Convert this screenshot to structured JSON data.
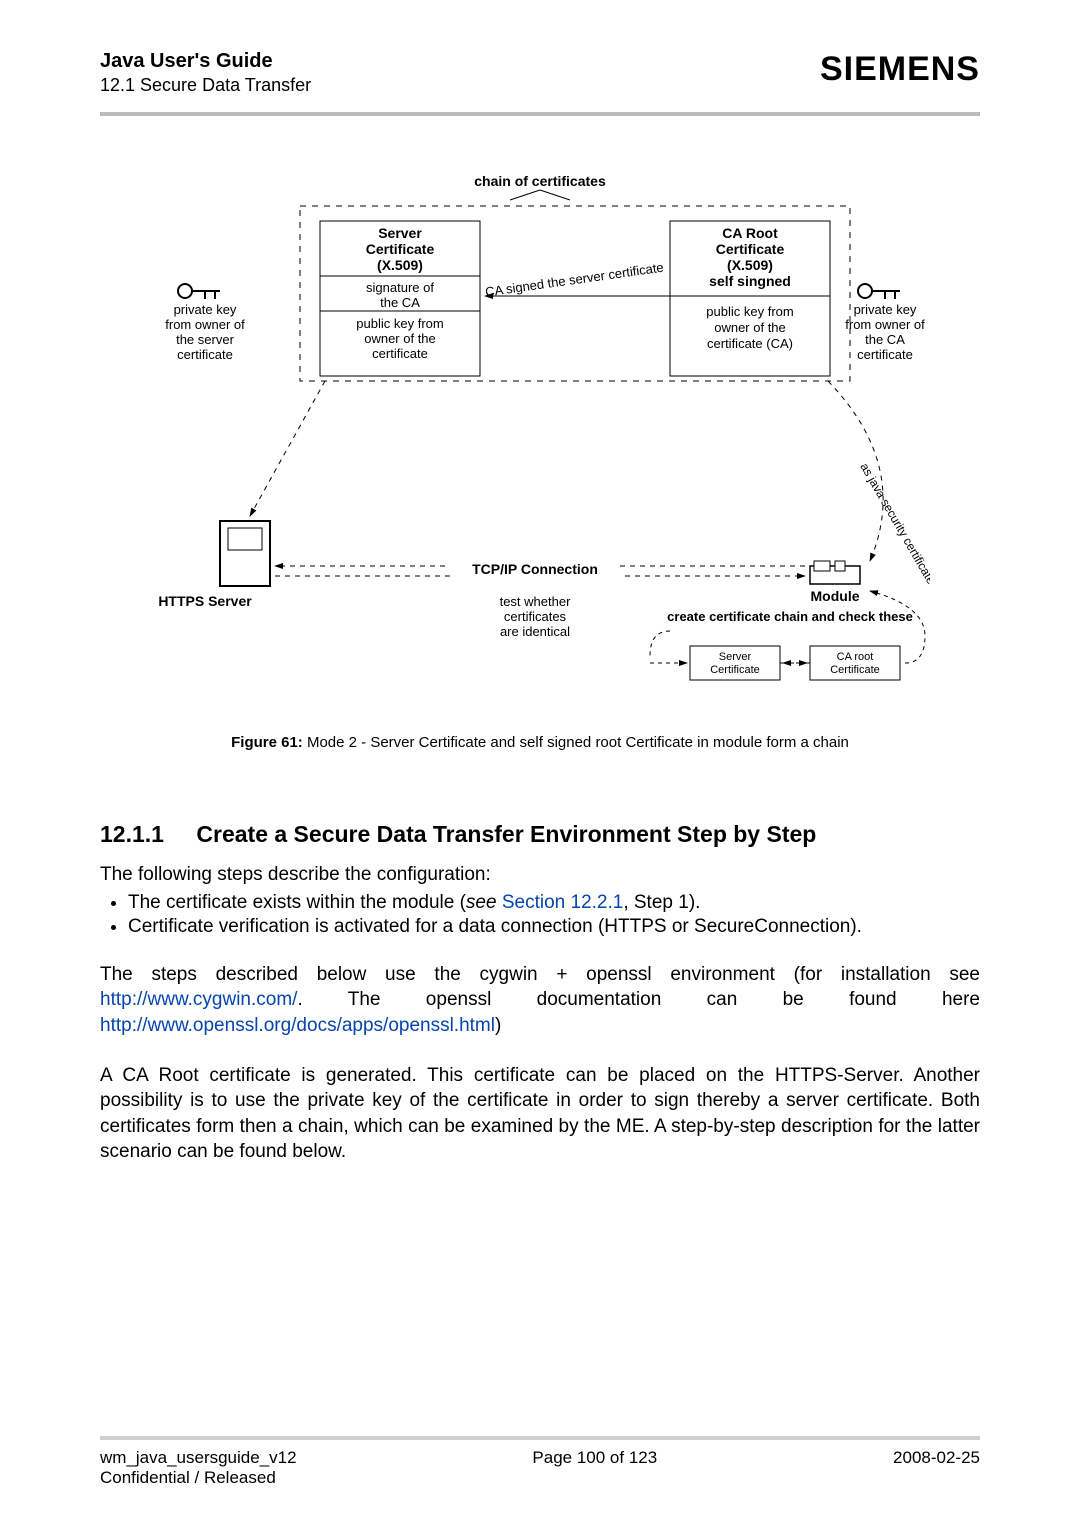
{
  "header": {
    "title": "Java User's Guide",
    "section": "12.1 Secure Data Transfer",
    "brand": "SIEMENS"
  },
  "figure": {
    "caption_label": "Figure 61:",
    "caption_text": "Mode 2 - Server Certificate and self signed root Certificate in module form a chain",
    "chain_title": "chain of certificates",
    "server_cert_l1": "Server",
    "server_cert_l2": "Certificate",
    "server_cert_l3": "(X.509)",
    "server_sig_l1": "signature of",
    "server_sig_l2": "the CA",
    "server_pk_l1": "public key from",
    "server_pk_l2": "owner of the",
    "server_pk_l3": "certificate",
    "ca_cert_l1": "CA Root",
    "ca_cert_l2": "Certificate",
    "ca_cert_l3": "(X.509)",
    "ca_cert_l4": "self singned",
    "ca_pk_l1": "public key from",
    "ca_pk_l2": "owner of the",
    "ca_pk_l3": "certificate (CA)",
    "priv_key_server_l1": "private key",
    "priv_key_server_l2": "from owner of",
    "priv_key_server_l3": "the server",
    "priv_key_server_l4": "certificate",
    "priv_key_ca_l1": "private key",
    "priv_key_ca_l2": "from owner of",
    "priv_key_ca_l3": "the CA",
    "priv_key_ca_l4": "certificate",
    "signed_label": "CA signed the server certificate",
    "java_sec_label": "as java security certificate",
    "tcpip": "TCP/IP Connection",
    "https_server": "HTTPS Server",
    "module": "Module",
    "test_l1": "test whether",
    "test_l2": "certificates",
    "test_l3": "are identical",
    "create_chain": "create certificate chain and check these",
    "server_cert_box": "Server",
    "server_cert_box2": "Certificate",
    "ca_root_box": "CA root",
    "ca_root_box2": "Certificate"
  },
  "section": {
    "num": "12.1.1",
    "title": "Create a Secure Data Transfer Environment Step by Step",
    "intro": "The following steps describe the configuration:",
    "bullet1_a": "The certificate exists within the module (",
    "bullet1_see": "see ",
    "bullet1_link": "Section 12.2.1",
    "bullet1_b": ", Step 1).",
    "bullet2": "Certificate verification is activated for a data connection (HTTPS or SecureConnection).",
    "p2a": "The steps described below use the cygwin + openssl environment (for installation see ",
    "p2_link1": "http://www.cygwin.com/",
    "p2b": ". The openssl documentation can be found here ",
    "p2_link2": "http://www.openssl.org/docs/apps/openssl.html",
    "p2c": ")",
    "p3": "A CA Root certificate is generated. This certificate can be placed on the HTTPS-Server. Another possibility is to use the private key of the certificate in order to sign thereby a server certificate. Both certificates form then a chain, which can be examined by the ME. A step-by-step description for the latter scenario can be found below."
  },
  "footer": {
    "left1": "wm_java_usersguide_v12",
    "left2": "Confidential / Released",
    "center": "Page 100 of 123",
    "right": "2008-02-25"
  }
}
